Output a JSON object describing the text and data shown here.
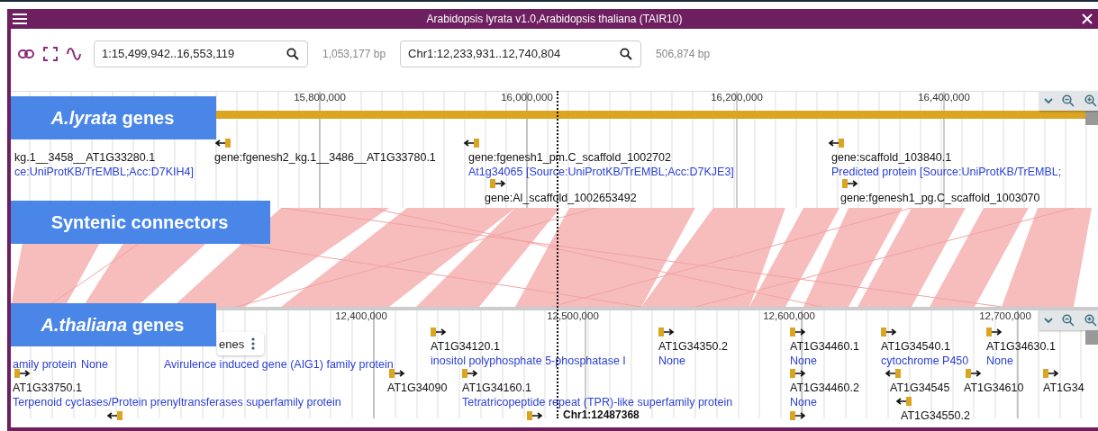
{
  "window": {
    "title": "Arabidopsis lyrata v1.0,Arabidopsis thaliana (TAIR10)"
  },
  "views": [
    {
      "location": "1:15,499,942..16,553,119",
      "length": "1,053,177 bp"
    },
    {
      "location": "Chr1:12,233,931..12,740,804",
      "length": "506,874 bp"
    }
  ],
  "overlay_labels": [
    "*A.lyrata* genes",
    "Syntenic connectors",
    "*A.thaliana* genes"
  ],
  "top_panel": {
    "ruler": [
      "15,800,000",
      "16,000,000",
      "16,200,000",
      "16,400,000"
    ],
    "features": [
      {
        "name": "kg.1__3458__AT1G33280.1",
        "description": "ce:UniProtKB/TrEMBL;Acc:D7KIH4]"
      },
      {
        "kind": "reverse",
        "name": "gene:fgenesh2_kg.1__3486__AT1G33780.1"
      },
      {
        "kind": "reverse",
        "name": "gene:fgenesh1_pm.C_scaffold_1002702",
        "description": "At1g34065 [Source:UniProtKB/TrEMBL;Acc:D7KJE3]"
      },
      {
        "kind": "reverse",
        "name": "gene:scaffold_103840.1",
        "description": "Predicted protein [Source:UniProtKB/TrEMBL;"
      },
      {
        "kind": "forward",
        "name": "gene:Al_scaffold_1002653492"
      },
      {
        "kind": "forward",
        "name": "gene:fgenesh1_pg.C_scaffold_1003070"
      }
    ]
  },
  "bottom_panel": {
    "ruler": [
      "12,400,000",
      "12,500,000",
      "12,600,000",
      "12,700,000"
    ],
    "track_menu": "enes",
    "cursor_label": "Chr1:12487368",
    "features": [
      {
        "kind": "forward",
        "name": "AT1G34120.1",
        "description": "inositol polyphosphate 5-phosphatase I"
      },
      {
        "kind": "forward",
        "name": "AT1G34350.2",
        "description": "None"
      },
      {
        "kind": "forward",
        "name": "AT1G34460.1",
        "description": "None"
      },
      {
        "kind": "forward",
        "name": "AT1G34540.1",
        "description": "cytochrome P450"
      },
      {
        "kind": "forward",
        "name": "AT1G34630.1",
        "description": "None"
      },
      {
        "description": "amily protein"
      },
      {
        "description": "None"
      },
      {
        "description": "Avirulence induced gene (AIG1) family protein"
      },
      {
        "kind": "forward",
        "name": "AT1G33750.1",
        "description": "Terpenoid cyclases/Protein prenyltransferases superfamily protein"
      },
      {
        "kind": "forward",
        "name": "AT1G34090"
      },
      {
        "kind": "forward",
        "name": "AT1G34160.1",
        "description": "Tetratricopeptide repeat (TPR)-like superfamily protein"
      },
      {
        "kind": "forward",
        "name": "AT1G34460.2",
        "description": "None"
      },
      {
        "kind": "reverse",
        "name": "AT1G34545"
      },
      {
        "kind": "forward",
        "name": "AT1G34610"
      },
      {
        "kind": "forward",
        "name": "AT1G34"
      },
      {
        "kind": "reverse",
        "name": "AT1G34550.2"
      },
      {
        "kind": "reverse"
      },
      {
        "kind": "forward"
      },
      {
        "kind": "forward"
      }
    ]
  }
}
